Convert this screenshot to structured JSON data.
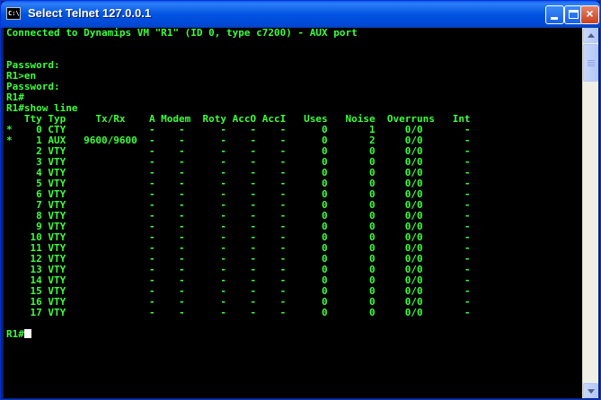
{
  "window": {
    "title": "Select Telnet 127.0.0.1",
    "icon_name": "console-window-icon",
    "icon_text": "C:\\"
  },
  "terminal": {
    "lines": [
      "Connected to Dynamips VM \"R1\" (ID 0, type c7200) - AUX port",
      "",
      "",
      "Password:",
      "R1>en",
      "Password:",
      "R1#",
      "R1#show line",
      "   Tty Typ     Tx/Rx    A Modem  Roty AccO AccI   Uses   Noise  Overruns   Int",
      "*    0 CTY              -    -      -    -    -      0       1     0/0       -",
      "*    1 AUX   9600/9600  -    -      -    -    -      0       2     0/0       -",
      "     2 VTY              -    -      -    -    -      0       0     0/0       -",
      "     3 VTY              -    -      -    -    -      0       0     0/0       -",
      "     4 VTY              -    -      -    -    -      0       0     0/0       -",
      "     5 VTY              -    -      -    -    -      0       0     0/0       -",
      "     6 VTY              -    -      -    -    -      0       0     0/0       -",
      "     7 VTY              -    -      -    -    -      0       0     0/0       -",
      "     8 VTY              -    -      -    -    -      0       0     0/0       -",
      "     9 VTY              -    -      -    -    -      0       0     0/0       -",
      "    10 VTY              -    -      -    -    -      0       0     0/0       -",
      "    11 VTY              -    -      -    -    -      0       0     0/0       -",
      "    12 VTY              -    -      -    -    -      0       0     0/0       -",
      "    13 VTY              -    -      -    -    -      0       0     0/0       -",
      "    14 VTY              -    -      -    -    -      0       0     0/0       -",
      "    15 VTY              -    -      -    -    -      0       0     0/0       -",
      "    16 VTY              -    -      -    -    -      0       0     0/0       -",
      "    17 VTY              -    -      -    -    -      0       0     0/0       -",
      ""
    ],
    "prompt": "R1#",
    "text_color": "#3cff3c",
    "background": "#000000"
  },
  "scrollbar": {
    "up_icon": "scroll-up-arrow-icon",
    "down_icon": "scroll-down-arrow-icon"
  }
}
